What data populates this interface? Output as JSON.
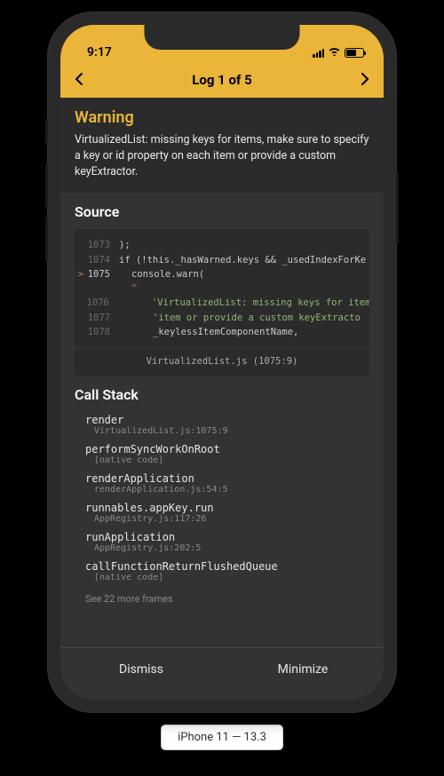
{
  "status": {
    "time": "9:17"
  },
  "nav": {
    "title": "Log 1 of 5"
  },
  "warning": {
    "title": "Warning",
    "message": "VirtualizedList: missing keys for items, make sure to specify a key or id property on each item or provide a custom keyExtractor."
  },
  "source": {
    "title": "Source",
    "lines": [
      {
        "n": "1073",
        "marker": "",
        "text": ");",
        "indent": 0
      },
      {
        "n": "1074",
        "marker": "",
        "text": "if (!this._hasWarned.keys && _usedIndexForKe",
        "indent": 0
      },
      {
        "n": "1075",
        "marker": ">",
        "text": "console.warn(",
        "indent": 1,
        "active": true
      },
      {
        "n": "",
        "marker": "",
        "text": "^",
        "indent": 1,
        "caret": true
      },
      {
        "n": "1076",
        "marker": "",
        "text": "'VirtualizedList: missing keys for items",
        "indent": 2,
        "kind": "str"
      },
      {
        "n": "1077",
        "marker": "",
        "text": "'item or provide a custom keyExtracto",
        "indent": 2,
        "kind": "str"
      },
      {
        "n": "1078",
        "marker": "",
        "text": "_keylessItemComponentName,",
        "indent": 2
      }
    ],
    "footer": "VirtualizedList.js (1075:9)"
  },
  "callstack": {
    "title": "Call Stack",
    "frames": [
      {
        "fn": "render",
        "loc": "VirtualizedList.js:1075:9"
      },
      {
        "fn": "performSyncWorkOnRoot",
        "loc": "[native code]"
      },
      {
        "fn": "renderApplication",
        "loc": "renderApplication.js:54:5"
      },
      {
        "fn": "runnables.appKey.run",
        "loc": "AppRegistry.js:117:26"
      },
      {
        "fn": "runApplication",
        "loc": "AppRegistry.js:202:5"
      },
      {
        "fn": "callFunctionReturnFlushedQueue",
        "loc": "[native code]"
      }
    ],
    "more": "See 22 more frames"
  },
  "footer": {
    "dismiss": "Dismiss",
    "minimize": "Minimize"
  },
  "device": "iPhone 11 — 13.3"
}
